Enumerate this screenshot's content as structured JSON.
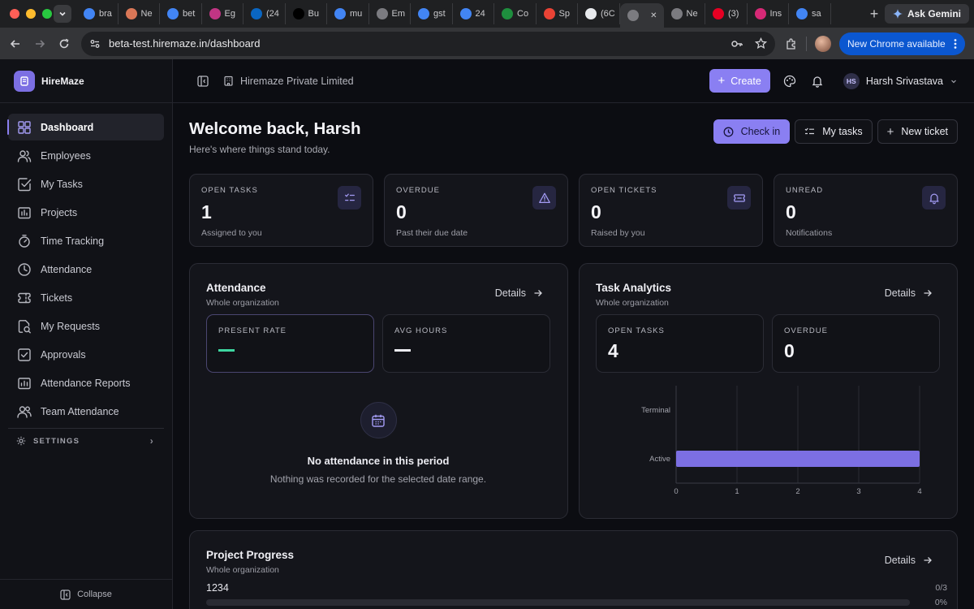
{
  "browser": {
    "tabs": [
      {
        "label": "bra",
        "icon": "google-icon",
        "color": "#4285f4"
      },
      {
        "label": "Ne",
        "icon": "claude-icon",
        "color": "#d97757"
      },
      {
        "label": "bet",
        "icon": "google-icon",
        "color": "#4285f4"
      },
      {
        "label": "Eg",
        "icon": "app-icon",
        "color": "#c13584"
      },
      {
        "label": "(24",
        "icon": "linkedin-icon",
        "color": "#0a66c2"
      },
      {
        "label": "Bu",
        "icon": "site-icon",
        "color": "#000000"
      },
      {
        "label": "mu",
        "icon": "google-icon",
        "color": "#4285f4"
      },
      {
        "label": "Em",
        "icon": "globe-icon",
        "color": "#7b7b80"
      },
      {
        "label": "gst",
        "icon": "google-icon",
        "color": "#4285f4"
      },
      {
        "label": "24",
        "icon": "google-icon",
        "color": "#4285f4"
      },
      {
        "label": "Co",
        "icon": "site-icon",
        "color": "#1e8e3e"
      },
      {
        "label": "Sp",
        "icon": "gmail-icon",
        "color": "#ea4335"
      },
      {
        "label": "(6C",
        "icon": "site-icon",
        "color": "#e8eaed"
      },
      {
        "label": "",
        "icon": "globe-icon",
        "color": "#7b7b80"
      },
      {
        "label": "Ne",
        "icon": "globe-icon",
        "color": "#7b7b80"
      },
      {
        "label": "(3)",
        "icon": "pinterest-icon",
        "color": "#e60023"
      },
      {
        "label": "Ins",
        "icon": "instagram-icon",
        "color": "#d62976"
      },
      {
        "label": "sa",
        "icon": "google-icon",
        "color": "#4285f4"
      }
    ],
    "gemini_label": "Ask Gemini",
    "url": "beta-test.hiremaze.in/dashboard",
    "new_chrome_label": "New Chrome available"
  },
  "app": {
    "brand": "HireMaze",
    "org": "Hiremaze Private Limited",
    "create_label": "Create",
    "user_initials": "HS",
    "user_name": "Harsh Srivastava",
    "nav": [
      {
        "label": "Dashboard",
        "icon": "dashboard-icon",
        "active": true
      },
      {
        "label": "Employees",
        "icon": "users-icon"
      },
      {
        "label": "My Tasks",
        "icon": "checkbox-icon"
      },
      {
        "label": "Projects",
        "icon": "projects-icon"
      },
      {
        "label": "Time Tracking",
        "icon": "stopwatch-icon"
      },
      {
        "label": "Attendance",
        "icon": "clock-icon"
      },
      {
        "label": "Tickets",
        "icon": "ticket-icon"
      },
      {
        "label": "My Requests",
        "icon": "requests-icon"
      },
      {
        "label": "Approvals",
        "icon": "approvals-icon"
      },
      {
        "label": "Attendance Reports",
        "icon": "report-icon"
      },
      {
        "label": "Team Attendance",
        "icon": "team-icon"
      }
    ],
    "settings_label": "SETTINGS",
    "collapse_label": "Collapse"
  },
  "main": {
    "welcome_title": "Welcome back, Harsh",
    "welcome_sub": "Here's where things stand today.",
    "checkin_label": "Check in",
    "mytasks_label": "My tasks",
    "newticket_label": "New ticket",
    "stats": [
      {
        "label": "OPEN TASKS",
        "value": "1",
        "sub": "Assigned to you",
        "icon": "tasks-icon"
      },
      {
        "label": "OVERDUE",
        "value": "0",
        "sub": "Past their due date",
        "icon": "warning-icon"
      },
      {
        "label": "OPEN TICKETS",
        "value": "0",
        "sub": "Raised by you",
        "icon": "ticket-icon"
      },
      {
        "label": "UNREAD",
        "value": "0",
        "sub": "Notifications",
        "icon": "bell-icon"
      }
    ],
    "attendance": {
      "title": "Attendance",
      "sub": "Whole organization",
      "details": "Details",
      "present_rate_label": "PRESENT RATE",
      "avg_hours_label": "AVG HOURS",
      "empty_title": "No attendance in this period",
      "empty_sub": "Nothing was recorded for the selected date range."
    },
    "task_analytics": {
      "title": "Task Analytics",
      "sub": "Whole organization",
      "details": "Details",
      "open_tasks_label": "OPEN TASKS",
      "open_tasks_value": "4",
      "overdue_label": "OVERDUE",
      "overdue_value": "0"
    },
    "project_progress": {
      "title": "Project Progress",
      "sub": "Whole organization",
      "details": "Details",
      "project_name": "1234",
      "count": "0/3",
      "percent": "0%",
      "fraction": 0
    }
  },
  "chart_data": {
    "type": "bar",
    "orientation": "horizontal",
    "categories": [
      "Terminal",
      "Active"
    ],
    "values": [
      0,
      4
    ],
    "xlim": [
      0,
      4
    ],
    "xticks": [
      "0",
      "1",
      "2",
      "3",
      "4"
    ],
    "grid": true,
    "color": "#7c6fe3"
  },
  "colors": {
    "accent": "#8a7ff2",
    "present_dash": "#3ed6a0"
  }
}
